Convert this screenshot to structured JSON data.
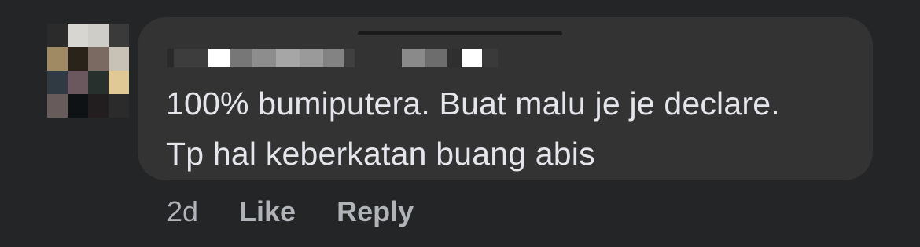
{
  "comment": {
    "text_line1": "100% bumiputera. Buat malu je je declare.",
    "text_line2": "Tp hal keberkatan buang abis"
  },
  "actions": {
    "timestamp": "2d",
    "like_label": "Like",
    "reply_label": "Reply"
  },
  "colors": {
    "background": "#242526",
    "bubble": "#333334",
    "text": "#e4e6eb",
    "meta_text": "#b0b3b8"
  },
  "avatar": {
    "icon": "pixelated-avatar-icon",
    "pixels": [
      "#2b2b2c",
      "#d8d6d0",
      "#cfcdc6",
      "#3a3a3b",
      "#a48a5c",
      "#2a2318",
      "#7d6a60",
      "#c9c2b4",
      "#2f3a44",
      "#6e5760",
      "#26302c",
      "#e4c98a",
      "#6a5a5c",
      "#0e1214",
      "#221e20",
      "#2b2b2c"
    ]
  },
  "name_redaction": {
    "pixels": [
      "#2a2a2b",
      "#3d3d3e",
      "#ffffff",
      "#777777",
      "#8d8d8d",
      "#a6a6a6",
      "#9a9a9a",
      "#838383",
      "#404041",
      "#333334",
      "#333334",
      "#8a8a8a",
      "#6d6d6d",
      "#2f2f30",
      "#ffffff",
      "#3a3a3b"
    ]
  }
}
